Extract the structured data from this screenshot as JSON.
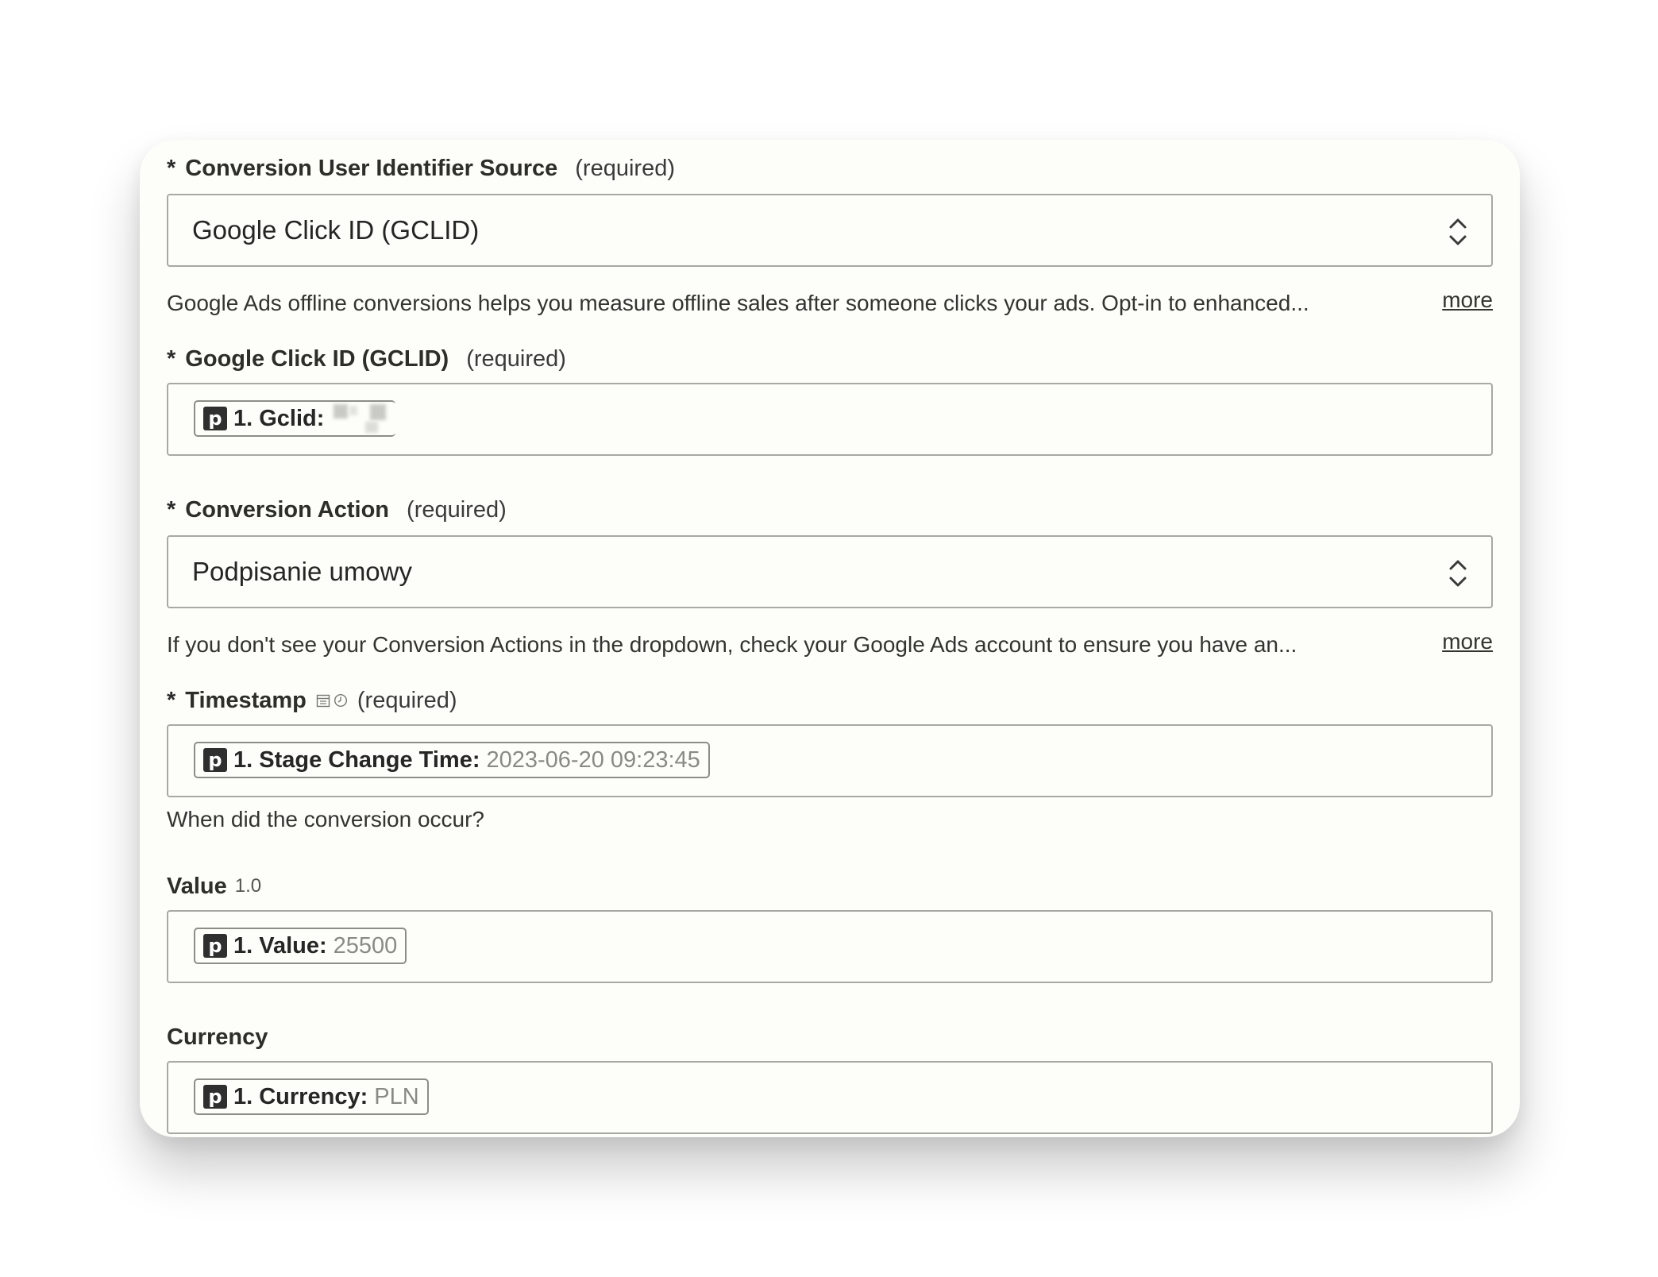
{
  "form": {
    "required_star": "*",
    "required_text": "(required)",
    "more_label": "more",
    "fields": {
      "source": {
        "label": "Conversion User Identifier Source",
        "value": "Google Click ID (GCLID)",
        "description": "Google Ads offline conversions helps you measure offline sales after someone clicks your ads. Opt-in to enhanced..."
      },
      "gclid": {
        "label": "Google Click ID (GCLID)",
        "pill_icon": "p",
        "pill_label": "1. Gclid:"
      },
      "action": {
        "label": "Conversion Action",
        "value": "Podpisanie umowy",
        "description": "If you don't see your Conversion Actions in the dropdown, check your Google Ads account to ensure you have an..."
      },
      "timestamp": {
        "label": "Timestamp",
        "pill_icon": "p",
        "pill_label": "1. Stage Change Time:",
        "pill_value": "2023-06-20 09:23:45",
        "description": "When did the conversion occur?"
      },
      "value": {
        "label": "Value",
        "version": "1.0",
        "pill_icon": "p",
        "pill_label": "1. Value:",
        "pill_value": "25500"
      },
      "currency": {
        "label": "Currency",
        "pill_icon": "p",
        "pill_label": "1. Currency:",
        "pill_value": "PLN"
      }
    }
  },
  "icons": {
    "dropdown": "chevron-up-down-icon",
    "timestamp": [
      "calendar-icon",
      "clock-icon"
    ],
    "pipedrive": "pipedrive-p-icon"
  },
  "colors": {
    "card_background": "#fdfdfa",
    "border": "#a9a9a3",
    "pill_icon_background": "#2f2f2f",
    "pill_value_text": "#8a8a85"
  }
}
